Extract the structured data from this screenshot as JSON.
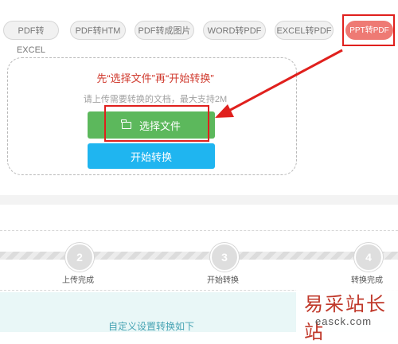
{
  "tabs": [
    {
      "label": "PDF转EXCEL"
    },
    {
      "label": "PDF转HTM"
    },
    {
      "label": "PDF转成图片"
    },
    {
      "label": "WORD转PDF"
    },
    {
      "label": "EXCEL转PDF"
    },
    {
      "label": "PPT转PDF",
      "active": true
    }
  ],
  "upload": {
    "instruction": "先“选择文件”再“开始转换”",
    "note": "请上传需要转换的文档，最大支持2M",
    "select_button": "选择文件",
    "start_button": "开始转换"
  },
  "steps": [
    {
      "number": "2",
      "label": "上传完成"
    },
    {
      "number": "3",
      "label": "开始转换"
    },
    {
      "number": "4",
      "label": "转换完成"
    }
  ],
  "custom_settings": "自定义设置转换如下",
  "watermark": {
    "title": "易采站长站",
    "url": "easck.com"
  },
  "colors": {
    "accent_red": "#e0201d",
    "active_tab": "#ee7a74",
    "select_green": "#5cb85c",
    "start_blue": "#1fb5f0"
  }
}
